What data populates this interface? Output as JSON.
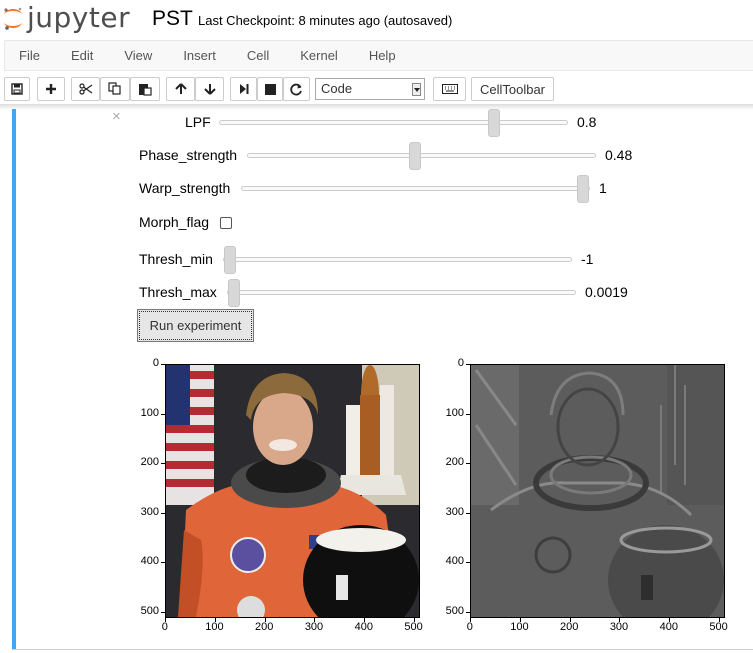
{
  "header": {
    "logo_text": "jupyter",
    "notebook_name": "PST",
    "checkpoint": "Last Checkpoint: 8 minutes ago (autosaved)"
  },
  "menubar": {
    "items": [
      "File",
      "Edit",
      "View",
      "Insert",
      "Cell",
      "Kernel",
      "Help"
    ]
  },
  "toolbar": {
    "icons": [
      "save-icon",
      "plus-icon",
      "cut-icon",
      "copy-icon",
      "paste-icon",
      "arrow-up-icon",
      "arrow-down-icon",
      "step-forward-icon",
      "stop-icon",
      "refresh-icon",
      "keyboard-icon"
    ],
    "cell_type": "Code",
    "celltoolbar_label": "CellToolbar"
  },
  "widgets": {
    "close_symbol": "×",
    "lpf": {
      "label": "LPF",
      "value": "0.8",
      "fraction": 0.8
    },
    "phase_strength": {
      "label": "Phase_strength",
      "value": "0.48",
      "fraction": 0.48
    },
    "warp_strength": {
      "label": "Warp_strength",
      "value": "1",
      "fraction": 1.0
    },
    "morph_flag": {
      "label": "Morph_flag",
      "checked": false
    },
    "thresh_min": {
      "label": "Thresh_min",
      "value": "-1",
      "fraction": 0.0
    },
    "thresh_max": {
      "label": "Thresh_max",
      "value": "0.0019",
      "fraction": 0.0
    },
    "run_button": "Run experiment"
  },
  "plots": {
    "left": {
      "content": "astronaut-photo",
      "xticks": [
        "0",
        "100",
        "200",
        "300",
        "400",
        "500"
      ],
      "yticks": [
        "0",
        "100",
        "200",
        "300",
        "400",
        "500"
      ]
    },
    "right": {
      "content": "astronaut-phase-stretch-output",
      "xticks": [
        "0",
        "100",
        "200",
        "300",
        "400",
        "500"
      ],
      "yticks": [
        "0",
        "100",
        "200",
        "300",
        "400",
        "500"
      ]
    }
  },
  "colors": {
    "cell_selected_bar": "#42a5f5",
    "logo_orange": "#f37726"
  }
}
